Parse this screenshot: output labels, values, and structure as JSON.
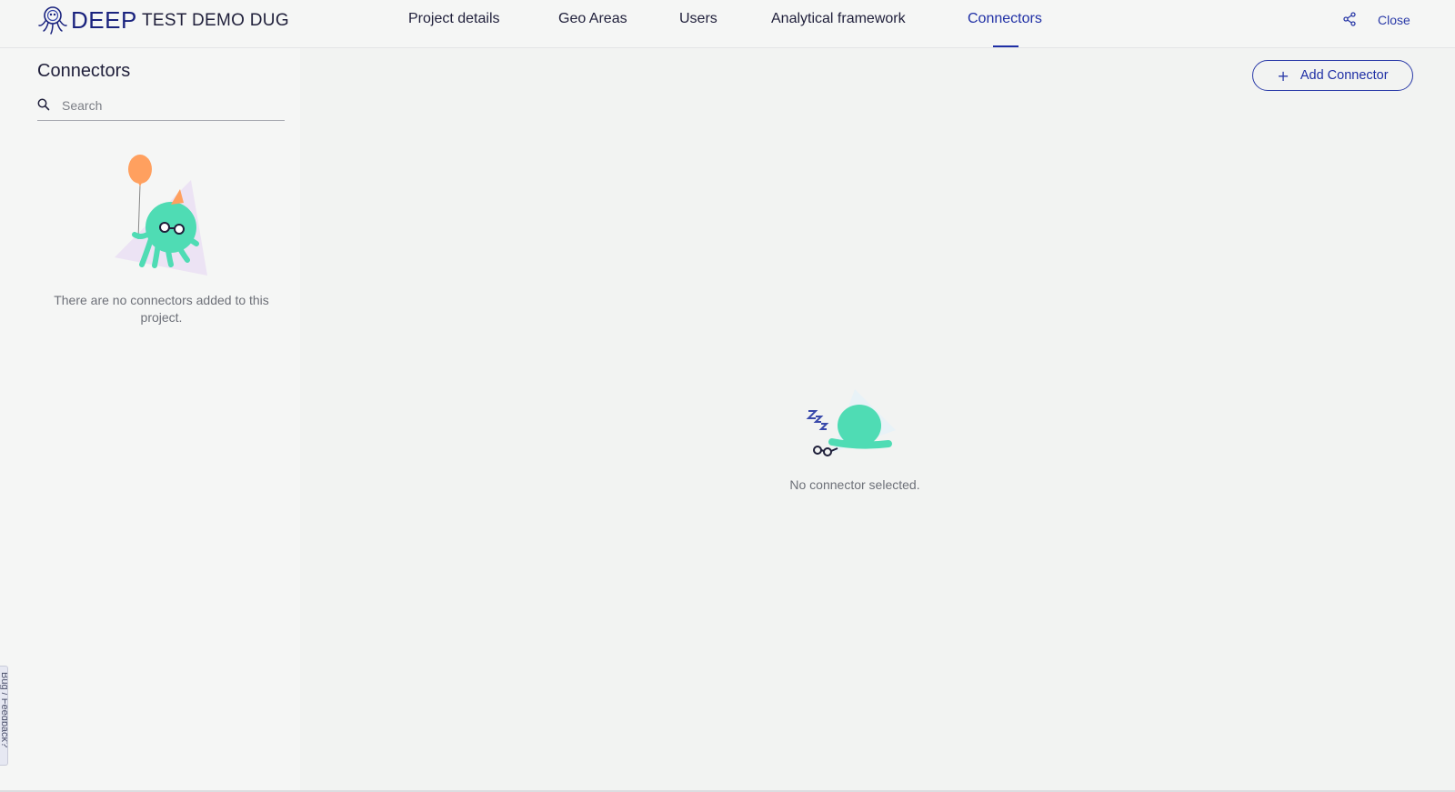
{
  "header": {
    "brand": {
      "name": "DEEP",
      "logo_icon": "octopus-logo-icon"
    },
    "project_name": "TEST DEMO DUG",
    "tabs": [
      {
        "label": "Project details",
        "active": false
      },
      {
        "label": "Geo Areas",
        "active": false
      },
      {
        "label": "Users",
        "active": false
      },
      {
        "label": "Analytical framework",
        "active": false
      },
      {
        "label": "Connectors",
        "active": true
      }
    ],
    "share_icon": "share-icon",
    "close_label": "Close"
  },
  "sidebar": {
    "title": "Connectors",
    "search": {
      "placeholder": "Search",
      "value": "",
      "icon": "search-icon"
    },
    "empty_message": "There are no connectors added to this project."
  },
  "main": {
    "add_button": {
      "label": "Add Connector",
      "icon": "plus-icon"
    },
    "empty_message": "No connector selected."
  },
  "feedback_tab": {
    "label": "Bug / Feedback?"
  },
  "colors": {
    "accent": "#1f2fa5",
    "background": "#f4f5f4",
    "mascot": "#4fdcb4",
    "balloon": "#ffa05f"
  }
}
